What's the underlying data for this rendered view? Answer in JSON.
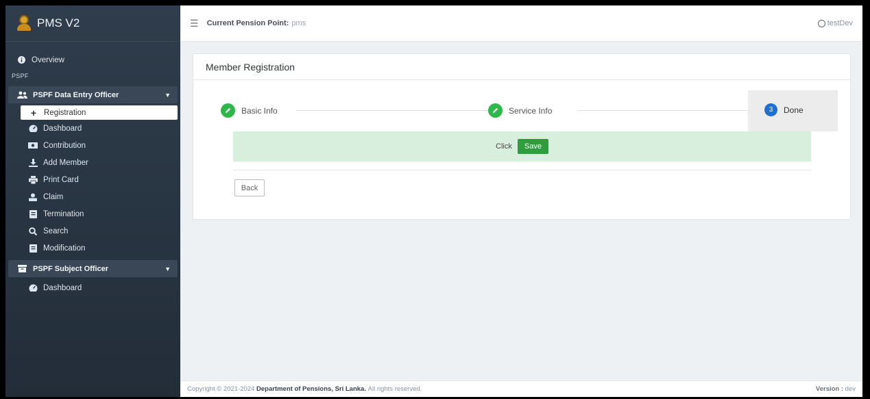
{
  "app": {
    "title": "PMS V2"
  },
  "sidebar": {
    "overview": "Overview",
    "section": "PSPF",
    "group1": {
      "label": "PSPF Data Entry Officer",
      "items": [
        {
          "label": "Registration",
          "icon": "plus-icon"
        },
        {
          "label": "Dashboard",
          "icon": "dashboard-icon"
        },
        {
          "label": "Contribution",
          "icon": "money-icon"
        },
        {
          "label": "Add Member",
          "icon": "download-icon"
        },
        {
          "label": "Print Card",
          "icon": "print-icon"
        },
        {
          "label": "Claim",
          "icon": "user-claim-icon"
        },
        {
          "label": "Termination",
          "icon": "doc-icon"
        },
        {
          "label": "Search",
          "icon": "search-icon"
        },
        {
          "label": "Modification",
          "icon": "doc-icon"
        }
      ]
    },
    "group2": {
      "label": "PSPF Subject Officer",
      "items": [
        {
          "label": "Dashboard",
          "icon": "dashboard-icon"
        }
      ]
    }
  },
  "topbar": {
    "pension_point_label": "Current Pension Point:",
    "pension_point_value": "pms",
    "user": "testDev"
  },
  "card": {
    "title": "Member Registration",
    "steps": [
      {
        "label": "Basic Info",
        "state": "complete"
      },
      {
        "label": "Service Info",
        "state": "complete"
      },
      {
        "label": "Done",
        "number": "3",
        "state": "active"
      }
    ],
    "alert_text": "Click",
    "save_label": "Save",
    "back_label": "Back"
  },
  "footer": {
    "copyright_prefix": "Copyright © 2021-2024",
    "organization": "Department of Pensions, Sri Lanka.",
    "rights": "All rights reserved.",
    "version_label": "Version :",
    "version_value": "dev"
  },
  "colors": {
    "sidebar_bg": "#2b3846",
    "success": "#2fb84a",
    "active_step": "#1f6fd1",
    "alert_bg": "#d8efdd",
    "save_button": "#2e9e3c"
  }
}
